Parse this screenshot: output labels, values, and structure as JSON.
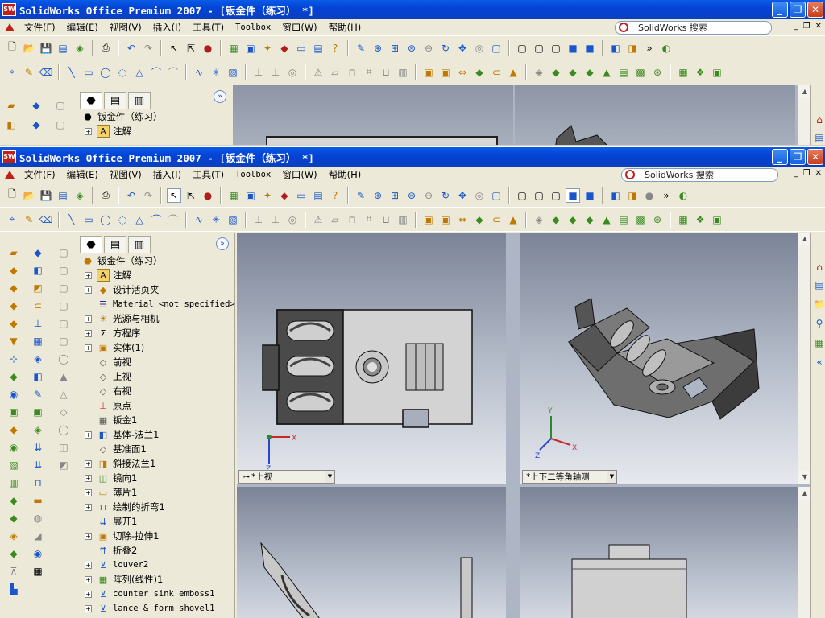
{
  "app": {
    "title": "SolidWorks Office Premium 2007 - [钣金件（练习） *]",
    "icon": "SW"
  },
  "window_controls": {
    "minimize": "_",
    "restore": "❐",
    "close": "✕"
  },
  "menu": [
    "文件(F)",
    "编辑(E)",
    "视图(V)",
    "插入(I)",
    "工具(T)",
    "Toolbox",
    "窗口(W)",
    "帮助(H)"
  ],
  "search": {
    "placeholder": "SolidWorks 搜索"
  },
  "feature_manager": {
    "tabs": [
      "feature-manager-tab",
      "property-manager-tab",
      "configuration-manager-tab"
    ],
    "items": [
      {
        "label": "钣金件（练习）",
        "expand": false,
        "icon": "part-icon",
        "root": true
      },
      {
        "label": "注解",
        "expand": true,
        "icon": "annotation-icon"
      },
      {
        "label": "设计活页夹",
        "expand": true,
        "icon": "design-binder-icon"
      },
      {
        "label": "Material <not specified>",
        "expand": false,
        "icon": "material-icon",
        "mono": true
      },
      {
        "label": "光源与相机",
        "expand": true,
        "icon": "lights-icon"
      },
      {
        "label": "方程序",
        "expand": true,
        "icon": "equations-icon"
      },
      {
        "label": "实体(1)",
        "expand": true,
        "icon": "solid-bodies-icon"
      },
      {
        "label": "前视",
        "expand": false,
        "icon": "plane-icon"
      },
      {
        "label": "上视",
        "expand": false,
        "icon": "plane-icon"
      },
      {
        "label": "右视",
        "expand": false,
        "icon": "plane-icon"
      },
      {
        "label": "原点",
        "expand": false,
        "icon": "origin-icon"
      },
      {
        "label": "钣金1",
        "expand": false,
        "icon": "sheetmetal-icon"
      },
      {
        "label": "基体-法兰1",
        "expand": true,
        "icon": "base-flange-icon"
      },
      {
        "label": "基准面1",
        "expand": false,
        "icon": "plane-icon"
      },
      {
        "label": "斜接法兰1",
        "expand": true,
        "icon": "miter-flange-icon"
      },
      {
        "label": "镜向1",
        "expand": true,
        "icon": "mirror-icon"
      },
      {
        "label": "薄片1",
        "expand": true,
        "icon": "tab-icon"
      },
      {
        "label": "绘制的折弯1",
        "expand": true,
        "icon": "sketched-bend-icon"
      },
      {
        "label": "展开1",
        "expand": false,
        "icon": "unfold-icon"
      },
      {
        "label": "切除-拉伸1",
        "expand": true,
        "icon": "cut-extrude-icon"
      },
      {
        "label": "折叠2",
        "expand": false,
        "icon": "fold-icon"
      },
      {
        "label": "louver2",
        "expand": true,
        "icon": "louver-icon",
        "mono": true
      },
      {
        "label": "阵列(线性)1",
        "expand": true,
        "icon": "linear-pattern-icon"
      },
      {
        "label": "counter sink emboss1",
        "expand": true,
        "icon": "emboss-icon",
        "mono": true
      },
      {
        "label": "lance & form shovel1",
        "expand": true,
        "icon": "lance-icon",
        "mono": true
      }
    ]
  },
  "bg_tree": [
    {
      "label": "钣金件（练习）",
      "icon": "part-icon",
      "root": true
    },
    {
      "label": "注解",
      "icon": "annotation-icon",
      "expand": true
    }
  ],
  "viewports": {
    "top_view_label": "*上视",
    "iso_view_label": "*上下二等角轴测",
    "axis_x": "X",
    "axis_y": "Y",
    "axis_z": "Z"
  }
}
